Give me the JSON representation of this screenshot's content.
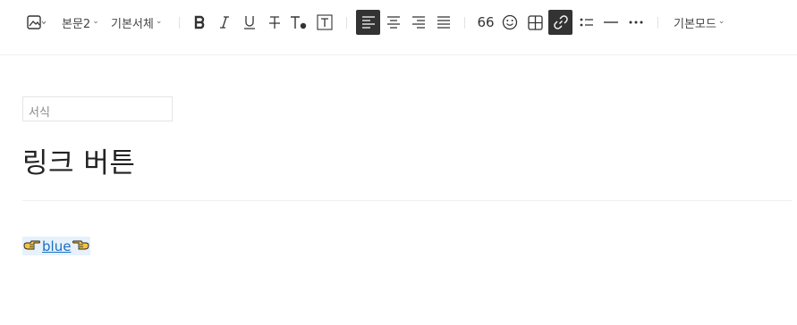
{
  "toolbar": {
    "paragraph_style": "본문2",
    "font_family": "기본서체",
    "mode": "기본모드",
    "quote_label": "66"
  },
  "editor": {
    "format_placeholder": "서식",
    "title": "링크 버튼",
    "link_text": "blue"
  },
  "colors": {
    "active_bg": "#333333",
    "link": "#1a6fc4",
    "link_highlight": "#e6f1fb",
    "hand_fill": "#f3c43f"
  },
  "icons": [
    "image-icon",
    "bold-icon",
    "italic-icon",
    "underline-icon",
    "strikethrough-icon",
    "text-color-icon",
    "text-background-icon",
    "align-left-icon",
    "align-center-icon",
    "align-right-icon",
    "align-justify-icon",
    "quote-icon",
    "emoji-icon",
    "table-icon",
    "link-icon",
    "list-icon",
    "horizontal-line-icon",
    "more-icon",
    "pointing-hand-icon"
  ]
}
